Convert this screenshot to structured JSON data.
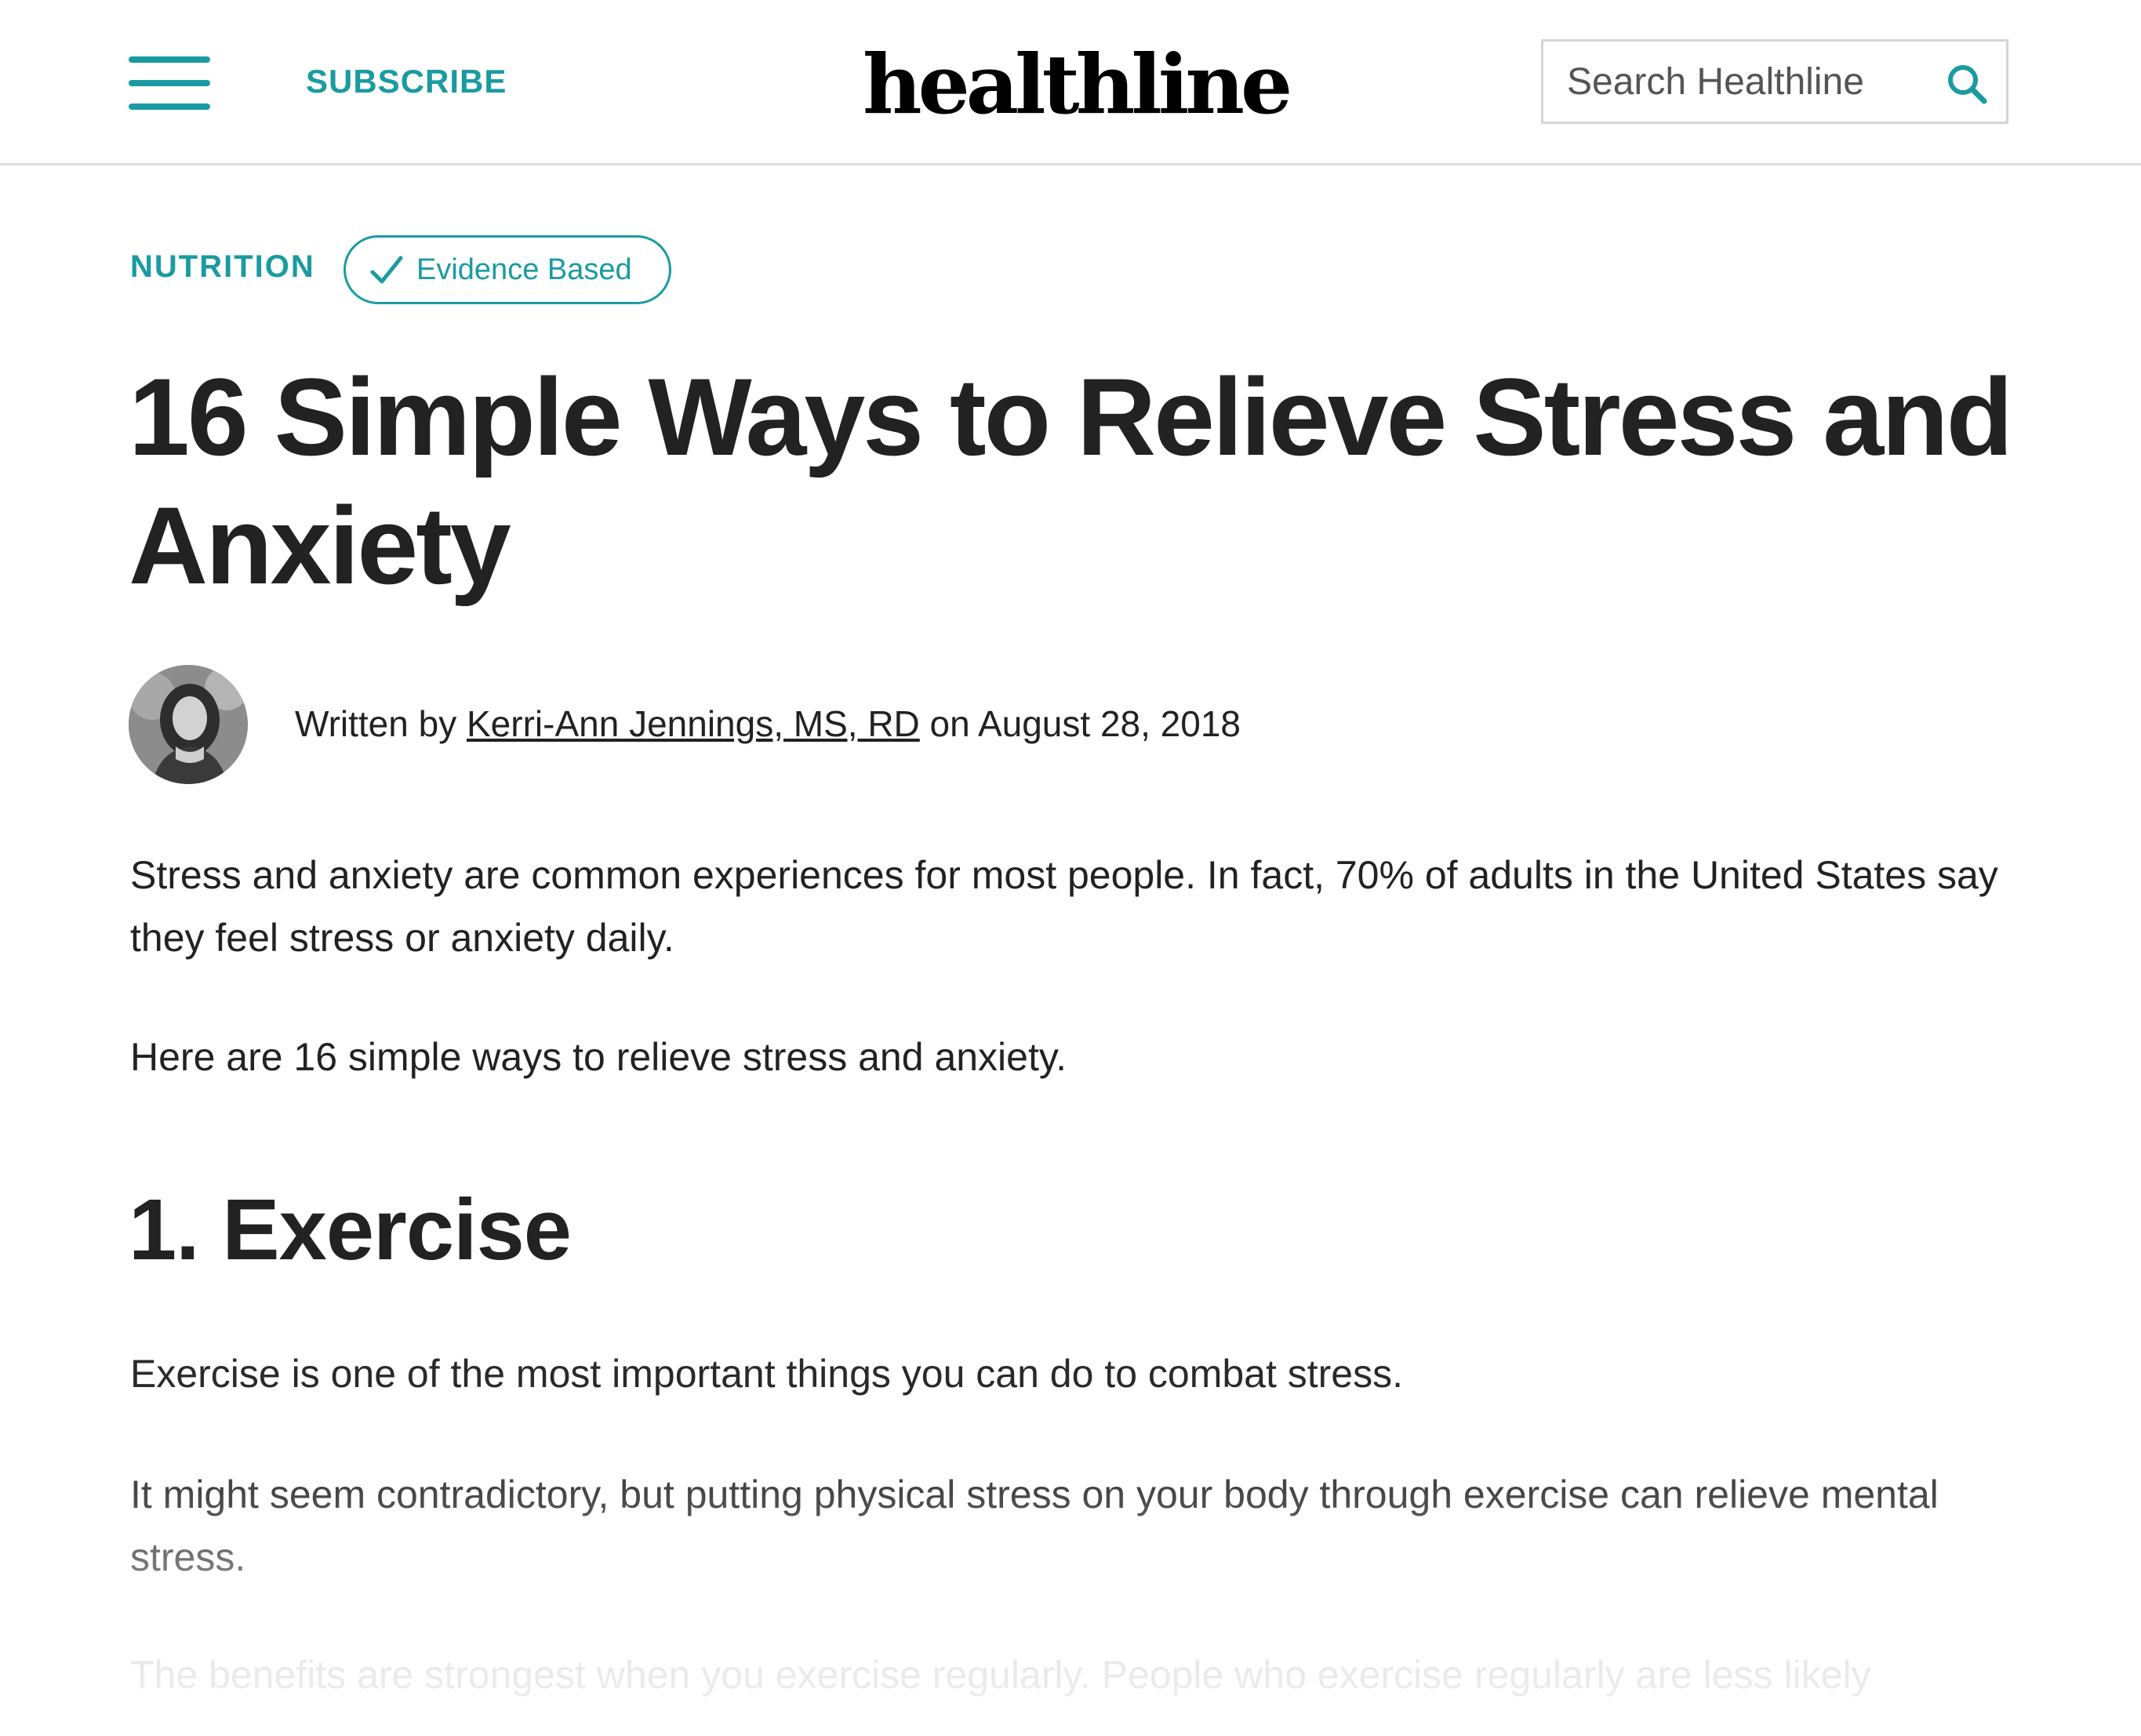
{
  "header": {
    "subscribe_label": "SUBSCRIBE",
    "logo_text": "healthline",
    "search_placeholder": "Search Healthline",
    "icons": [
      "hamburger-menu-icon",
      "search-icon"
    ]
  },
  "article": {
    "category": "NUTRITION",
    "badge_label": "Evidence Based",
    "title": "16 Simple Ways to Relieve Stress and Anxiety",
    "byline": {
      "prefix": "Written by",
      "author": "Kerri-Ann Jennings, MS, RD",
      "date_text": "on August 28, 2018"
    },
    "paragraphs": [
      "Stress and anxiety are common experiences for most people. In fact, 70% of adults in the United States say they feel stress or anxiety daily.",
      "Here are 16 simple ways to relieve stress and anxiety."
    ],
    "sections": [
      {
        "heading": "1. Exercise",
        "paragraphs": [
          "Exercise is one of the most important things you can do to combat stress.",
          "It might seem contradictory, but putting physical stress on your body through exercise can relieve mental stress.",
          "The benefits are strongest when you exercise regularly. People who exercise regularly are less likely"
        ]
      }
    ]
  },
  "colors": {
    "accent": "#1a9ba1",
    "text": "#222222",
    "border": "#dcdcdc"
  }
}
